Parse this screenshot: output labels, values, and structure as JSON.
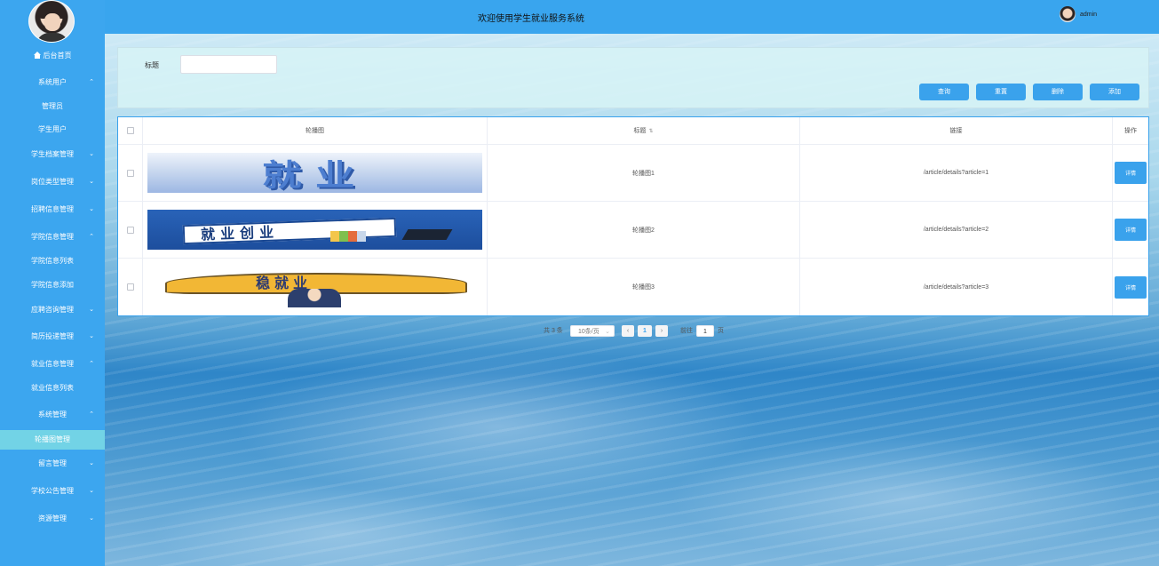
{
  "header": {
    "title": "欢迎使用学生就业服务系统",
    "user": "admin"
  },
  "sidebar": {
    "home": "后台首页",
    "items": [
      {
        "label": "系统用户",
        "expanded": true
      },
      {
        "label": "管理员",
        "sub": true
      },
      {
        "label": "学生用户",
        "sub": true
      },
      {
        "label": "学生档案管理",
        "expanded": false
      },
      {
        "label": "岗位类型管理",
        "expanded": false
      },
      {
        "label": "招聘信息管理",
        "expanded": false
      },
      {
        "label": "学院信息管理",
        "expanded": true
      },
      {
        "label": "学院信息列表",
        "sub": true
      },
      {
        "label": "学院信息添加",
        "sub": true
      },
      {
        "label": "应聘咨询管理",
        "expanded": false
      },
      {
        "label": "简历投递管理",
        "expanded": false
      },
      {
        "label": "就业信息管理",
        "expanded": true
      },
      {
        "label": "就业信息列表",
        "sub": true
      },
      {
        "label": "系统管理",
        "expanded": true
      },
      {
        "label": "轮播图管理",
        "sub": true,
        "active": true
      },
      {
        "label": "留言管理",
        "expanded": false
      },
      {
        "label": "学校公告管理",
        "expanded": false
      },
      {
        "label": "资源管理",
        "expanded": false
      }
    ]
  },
  "search": {
    "label": "标题",
    "value": "",
    "buttons": {
      "query": "查询",
      "reset": "重置",
      "delete": "删除",
      "add": "添加"
    }
  },
  "table": {
    "columns": {
      "image": "轮播图",
      "title": "标题",
      "link": "链接",
      "action": "操作"
    },
    "rows": [
      {
        "banner_text": "就业",
        "title": "轮播图1",
        "link": "/article/details?article=1",
        "action": "详情"
      },
      {
        "banner_text": "就业创业",
        "title": "轮播图2",
        "link": "/article/details?article=2",
        "action": "详情"
      },
      {
        "banner_text": "稳就业",
        "title": "轮播图3",
        "link": "/article/details?article=3",
        "action": "详情"
      }
    ]
  },
  "pagination": {
    "total": "共 3 条",
    "page_size": "10条/页",
    "current_page": "1",
    "goto_label": "前往",
    "goto_value": "1",
    "page_unit": "页"
  },
  "colors": {
    "primary": "#3aa2ec",
    "sidebar": "#3ca6ef",
    "active_menu": "#72d3e6"
  }
}
